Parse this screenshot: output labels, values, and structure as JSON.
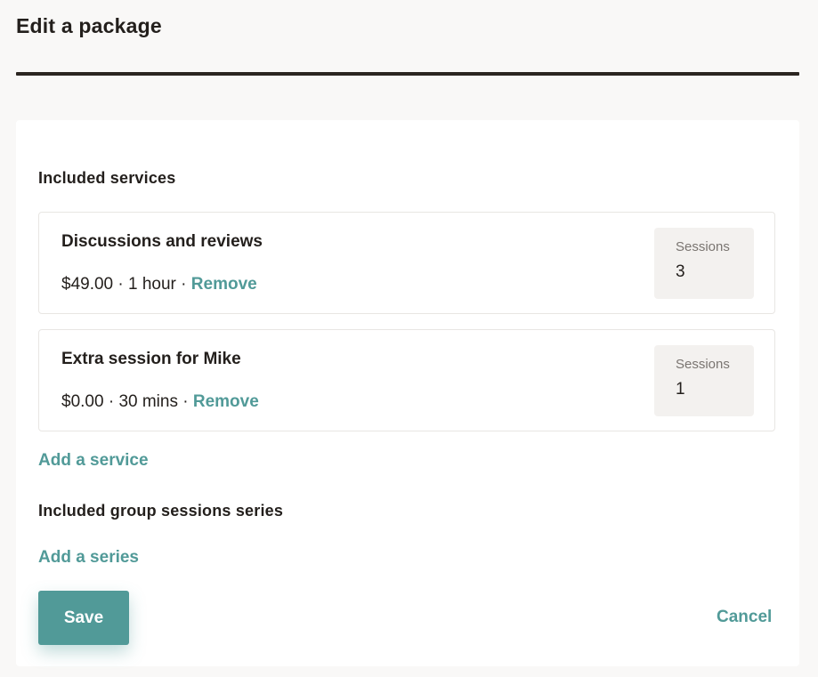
{
  "page": {
    "title": "Edit a package"
  },
  "included_services": {
    "heading": "Included services",
    "items": [
      {
        "name": "Discussions and reviews",
        "price": "$49.00",
        "duration": "1 hour",
        "remove_label": "Remove",
        "sessions_label": "Sessions",
        "sessions_value": "3"
      },
      {
        "name": "Extra session for Mike",
        "price": "$0.00",
        "duration": "30 mins",
        "remove_label": "Remove",
        "sessions_label": "Sessions",
        "sessions_value": "1"
      }
    ],
    "add_label": "Add a service"
  },
  "group_sessions": {
    "heading": "Included group sessions series",
    "add_label": "Add a series"
  },
  "actions": {
    "save_label": "Save",
    "cancel_label": "Cancel"
  },
  "colors": {
    "accent": "#519a98",
    "text": "#231f1c",
    "page_background": "#f9f8f7",
    "card_background": "#ffffff",
    "sessions_background": "#f3f1ef"
  },
  "separator": " · "
}
